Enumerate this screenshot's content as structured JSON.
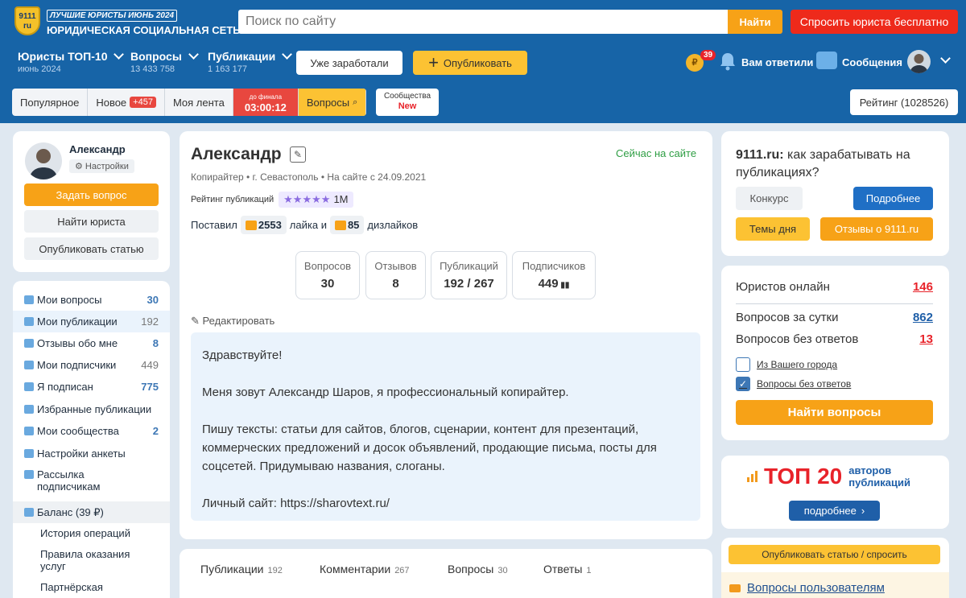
{
  "header": {
    "logo_badge": "9111 ru",
    "logo_tagline": "ЛУЧШИЕ ЮРИСТЫ ИЮНЬ 2024",
    "logo_title": "ЮРИДИЧЕСКАЯ СОЦИАЛЬНАЯ СЕТЬ",
    "search_placeholder": "Поиск по сайту",
    "find_label": "Найти",
    "ask_label": "Спросить юриста бесплатно",
    "nav": [
      {
        "title": "Юристы ТОП-10",
        "sub": "июнь 2024"
      },
      {
        "title": "Вопросы",
        "sub": "13 433 758"
      },
      {
        "title": "Публикации",
        "sub": "1 163 177"
      }
    ],
    "earned_label": "Уже заработали",
    "publish_label": "Опубликовать",
    "coin_symbol": "₽",
    "coin_badge": "39",
    "answered_label": "Вам ответили",
    "messages_label": "Сообщения"
  },
  "tabs": {
    "popular": "Популярное",
    "new": "Новое",
    "new_badge": "+457",
    "feed": "Моя лента",
    "final_top": "до финала",
    "final_timer": "03:00:12",
    "questions": "Вопросы",
    "communities": "Сообщества",
    "communities_new": "New",
    "rating": "Рейтинг (1028526)"
  },
  "user_card": {
    "name": "Александр",
    "settings": "Настройки",
    "ask_button": "Задать вопрос",
    "find_lawyer": "Найти юриста",
    "publish_article": "Опубликовать статью"
  },
  "menu": {
    "items": [
      {
        "label": "Мои вопросы",
        "count": "30"
      },
      {
        "label": "Мои публикации",
        "count": "192"
      },
      {
        "label": "Отзывы обо мне",
        "count": "8"
      },
      {
        "label": "Мои подписчики",
        "count": "449"
      },
      {
        "label": "Я подписан",
        "count": "775"
      },
      {
        "label": "Избранные публикации",
        "count": ""
      },
      {
        "label": "Мои сообщества",
        "count": "2"
      },
      {
        "label": "Настройки анкеты",
        "count": ""
      },
      {
        "label": "Рассылка подписчикам",
        "count": ""
      },
      {
        "label": "Баланс (39 ₽)",
        "count": ""
      }
    ],
    "sub_items": [
      "История операций",
      "Правила оказания услуг",
      "Партнёрская"
    ]
  },
  "profile": {
    "name": "Александр",
    "online": "Сейчас на сайте",
    "meta": "Копирайтер • г. Севастополь • На сайте с 24.09.2021",
    "rating_label": "Рейтинг публикаций",
    "rating_stars": "★★★★★",
    "rating_value": "1M",
    "likes_prefix": "Поставил",
    "likes_count": "2553",
    "likes_mid": "лайка и",
    "dislikes_count": "85",
    "dislikes_suffix": "дизлайков",
    "stats": [
      {
        "label": "Вопросов",
        "value": "30"
      },
      {
        "label": "Отзывов",
        "value": "8"
      },
      {
        "label": "Публикаций",
        "value": "192 / 267"
      },
      {
        "label": "Подписчиков",
        "value": "449"
      }
    ],
    "edit_label": "Редактировать",
    "about": [
      "Здравствуйте!",
      "Меня зовут Александр Шаров, я профессиональный копирайтер.",
      "Пишу тексты: статьи для сайтов, блогов, сценарии, контент для презентаций, коммерческих предложений и досок объявлений, продающие письма, посты для соцсетей. Придумываю названия, слоганы.",
      "Личный сайт: https://sharovtext.ru/"
    ],
    "tabs": [
      {
        "label": "Публикации",
        "count": "192"
      },
      {
        "label": "Комментарии",
        "count": "267"
      },
      {
        "label": "Вопросы",
        "count": "30"
      },
      {
        "label": "Ответы",
        "count": "1"
      }
    ]
  },
  "right": {
    "promo_brand": "9111.ru:",
    "promo_text": " как зарабатывать на публикациях?",
    "contest": "Конкурс",
    "details": "Подробнее",
    "topics": "Темы дня",
    "reviews": "Отзывы о 9111.ru",
    "stats": [
      {
        "label": "Юристов онлайн",
        "value": "146",
        "color": "#e8232a"
      },
      {
        "label": "Вопросов за сутки",
        "value": "862",
        "color": "#1f5fa8"
      },
      {
        "label": "Вопросов без ответов",
        "value": "13",
        "color": "#e8232a"
      }
    ],
    "check_city": "Из Вашего города",
    "check_unanswered": "Вопросы без ответов",
    "find_questions": "Найти вопросы",
    "top_big": "ТОП 20",
    "top_small": "авторов публикаций",
    "more": "подробнее",
    "publish_ask": "Опубликовать статью / спросить",
    "users_questions": "Вопросы пользователям"
  }
}
